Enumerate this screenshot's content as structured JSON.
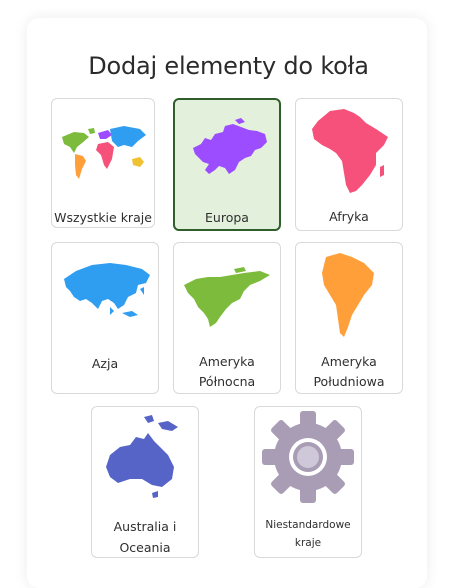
{
  "title": "Dodaj elementy do koła",
  "cards": [
    {
      "id": "all",
      "label": "Wszystkie kraje",
      "selected": false
    },
    {
      "id": "europe",
      "label": "Europa",
      "selected": true
    },
    {
      "id": "africa",
      "label": "Afryka",
      "selected": false
    },
    {
      "id": "asia",
      "label": "Azja",
      "selected": false
    },
    {
      "id": "north_america",
      "label_line1": "Ameryka",
      "label_line2": "Północna",
      "selected": false
    },
    {
      "id": "south_america",
      "label_line1": "Ameryka",
      "label_line2": "Południowa",
      "selected": false
    },
    {
      "id": "oceania",
      "label_line1": "Australia i",
      "label_line2": "Oceania",
      "selected": false
    },
    {
      "id": "custom",
      "label_line1": "Niestandardowe",
      "label_line2": "kraje",
      "selected": false
    }
  ],
  "colors": {
    "selected_bg": "#e3f0dc",
    "selected_border": "#2f5e2c",
    "europe": "#9b4dff",
    "africa": "#f5517a",
    "asia": "#2f9df0",
    "north_america": "#7dbb3c",
    "south_america": "#ff9f3a",
    "oceania": "#5564c6",
    "gear": "#a89db5"
  },
  "icons": [
    "world-map-icon",
    "europe-map-icon",
    "africa-map-icon",
    "asia-map-icon",
    "north-america-map-icon",
    "south-america-map-icon",
    "australia-map-icon",
    "gear-icon"
  ]
}
